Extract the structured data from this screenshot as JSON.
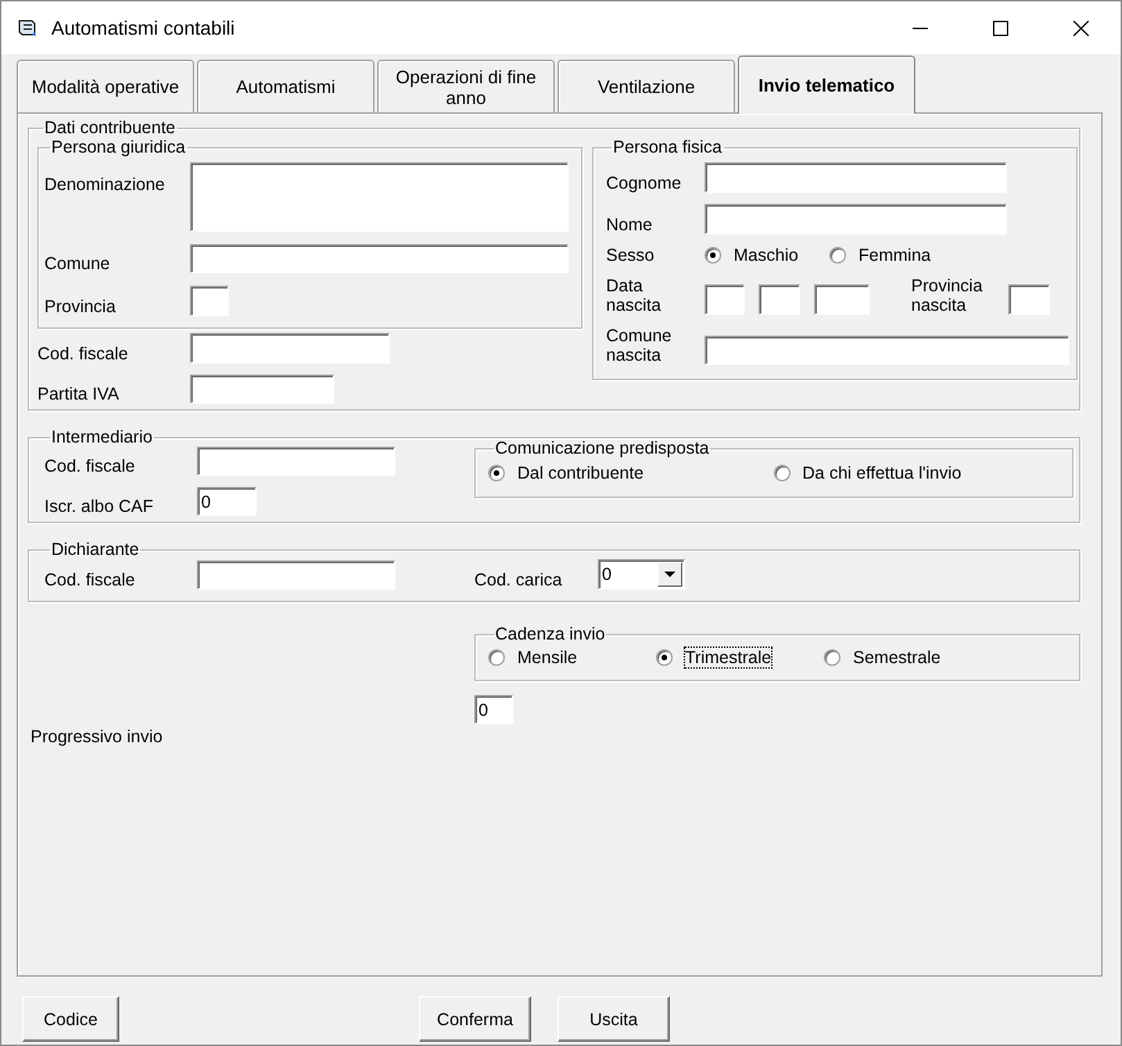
{
  "window": {
    "title": "Automatismi contabili"
  },
  "tabs": [
    {
      "label": "Modalità operative",
      "selected": false
    },
    {
      "label": "Automatismi",
      "selected": false
    },
    {
      "label": "Operazioni di fine anno",
      "selected": false
    },
    {
      "label": "Ventilazione",
      "selected": false
    },
    {
      "label": "Invio telematico",
      "selected": true
    }
  ],
  "dati_contribuente": {
    "title": "Dati contribuente",
    "persona_giuridica": {
      "title": "Persona giuridica",
      "denominazione": {
        "label": "Denominazione"
      },
      "comune": {
        "label": "Comune"
      },
      "provincia": {
        "label": "Provincia"
      }
    },
    "cod_fiscale": {
      "label": "Cod. fiscale"
    },
    "partita_iva": {
      "label": "Partita IVA"
    },
    "persona_fisica": {
      "title": "Persona fisica",
      "cognome": {
        "label": "Cognome"
      },
      "nome": {
        "label": "Nome"
      },
      "sesso": {
        "label": "Sesso",
        "options": [
          {
            "label": "Maschio",
            "selected": true
          },
          {
            "label": "Femmina",
            "selected": false
          }
        ]
      },
      "data_nascita": {
        "label": "Data nascita"
      },
      "provincia_nascita": {
        "label": "Provincia nascita"
      },
      "comune_nascita": {
        "label": "Comune nascita"
      }
    }
  },
  "intermediario": {
    "title": "Intermediario",
    "cod_fiscale": {
      "label": "Cod. fiscale"
    },
    "iscr_albo_caf": {
      "label": "Iscr. albo CAF",
      "value": "0"
    },
    "comunicazione": {
      "title": "Comunicazione predisposta",
      "options": [
        {
          "label": "Dal contribuente",
          "selected": true
        },
        {
          "label": "Da chi effettua l'invio",
          "selected": false
        }
      ]
    }
  },
  "dichiarante": {
    "title": "Dichiarante",
    "cod_fiscale": {
      "label": "Cod. fiscale"
    },
    "cod_carica": {
      "label": "Cod. carica",
      "value": "0"
    }
  },
  "cadenza_invio": {
    "title": "Cadenza invio",
    "options": [
      {
        "label": "Mensile",
        "selected": false,
        "focused": false
      },
      {
        "label": "Trimestrale",
        "selected": true,
        "focused": true
      },
      {
        "label": "Semestrale",
        "selected": false,
        "focused": false
      }
    ]
  },
  "progressivo_invio": {
    "label": "Progressivo invio",
    "value": "0"
  },
  "buttons": [
    {
      "label": "Codice"
    },
    {
      "label": "Conferma"
    },
    {
      "label": "Uscita"
    }
  ]
}
